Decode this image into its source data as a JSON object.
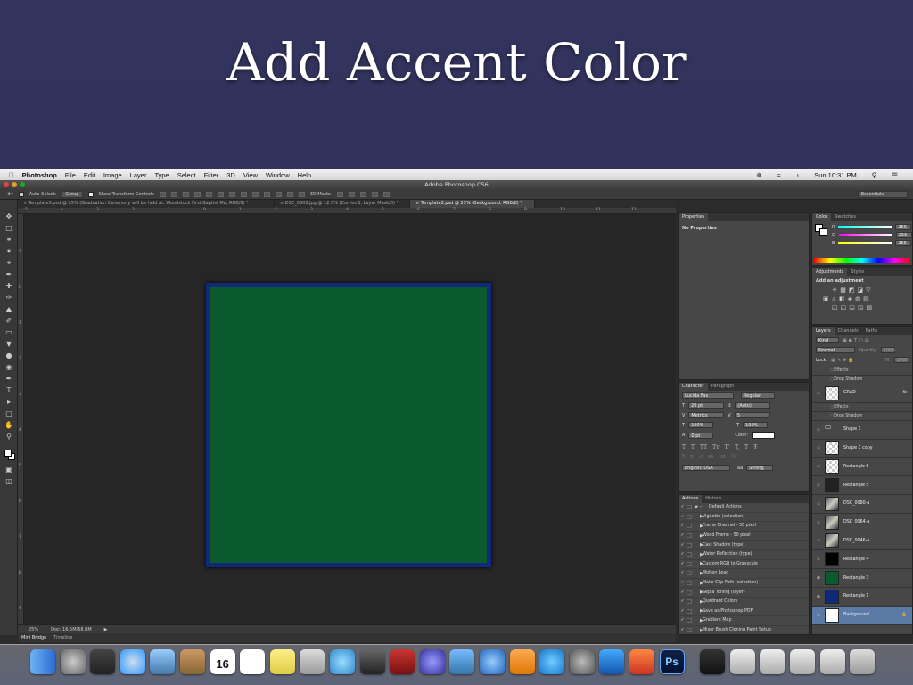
{
  "slide": {
    "title": "Add Accent Color"
  },
  "menubar": {
    "apple": "",
    "app": "Photoshop",
    "items": [
      "File",
      "Edit",
      "Image",
      "Layer",
      "Type",
      "Select",
      "Filter",
      "3D",
      "View",
      "Window",
      "Help"
    ],
    "clock": "Sun 10:31 PM"
  },
  "window": {
    "title": "Adobe Photoshop CS6"
  },
  "options": {
    "auto_select_label": "Auto-Select:",
    "auto_select_value": "Group",
    "show_transform": "Show Transform Controls",
    "mode_3d": "3D Mode:",
    "workspace": "Essentials"
  },
  "tabs": [
    {
      "label": "Template5.psd @ 25% (Graduation Ceremony will be held at: Woodstock First Baptist Ma, RGB/8) *"
    },
    {
      "label": "DSC_0302.jpg @ 12.5% (Curves 1, Layer Mask/8) *"
    },
    {
      "label": "Template2.psd @ 25% (Background, RGB/8) *"
    }
  ],
  "ruler_h": [
    "5",
    "4",
    "3",
    "2",
    "1",
    "0",
    "1",
    "2",
    "3",
    "4",
    "5",
    "6",
    "7",
    "8",
    "9",
    "10",
    "11",
    "12"
  ],
  "ruler_v": [
    "1",
    "0",
    "1",
    "2",
    "3",
    "4",
    "5",
    "6",
    "7",
    "8",
    "9"
  ],
  "status": {
    "zoom": "25%",
    "doc": "Doc: 16.5M/68.8M"
  },
  "bottom_tabs": {
    "mini_bridge": "Mini Bridge",
    "timeline": "Timeline"
  },
  "properties": {
    "tab": "Properties",
    "content": "No Properties"
  },
  "color_panel": {
    "tabs": [
      "Color",
      "Swatches"
    ],
    "channels": [
      {
        "label": "R",
        "value": "255"
      },
      {
        "label": "G",
        "value": "255"
      },
      {
        "label": "B",
        "value": "255"
      }
    ]
  },
  "adjustments": {
    "tabs": [
      "Adjustments",
      "Styles"
    ],
    "heading": "Add an adjustment"
  },
  "character": {
    "tabs": [
      "Character",
      "Paragraph"
    ],
    "font": "Lucida Fax",
    "style": "Regular",
    "size": "20 pt",
    "leading": "(Auto)",
    "kerning": "Metrics",
    "tracking": "5",
    "vscale": "100%",
    "hscale": "100%",
    "baseline": "0 pt",
    "color_label": "Color:",
    "language": "English: USA",
    "aa": "Strong"
  },
  "actions": {
    "tabs": [
      "Actions",
      "History"
    ],
    "items": [
      "Default Actions",
      "Vignette (selection)",
      "Frame Channel - 50 pixel",
      "Wood Frame - 50 pixel",
      "Cast Shadow (type)",
      "Water Reflection (type)",
      "Custom RGB to Grayscale",
      "Molten Lead",
      "Make Clip Path (selection)",
      "Sepia Toning (layer)",
      "Quadrant Colors",
      "Save as Photoshop PDF",
      "Gradient Map",
      "Mixer Brush Cloning Paint Setup"
    ]
  },
  "layers": {
    "tabs": [
      "Layers",
      "Channels",
      "Paths"
    ],
    "kind": "Kind",
    "blend": "Normal",
    "opacity_label": "Opacity:",
    "opacity": "100%",
    "lock_label": "Lock:",
    "fill_label": "Fill:",
    "fill": "100%",
    "rows": [
      {
        "name": "Effects",
        "sub": true
      },
      {
        "name": "Drop Shadow",
        "sub": true
      },
      {
        "name": "GRAD",
        "sub": false,
        "thumb": "checker"
      },
      {
        "name": "Effects",
        "sub": true
      },
      {
        "name": "Drop Shadow",
        "sub": true
      },
      {
        "name": "Shape 1",
        "sub": false,
        "thumb": "group"
      },
      {
        "name": "Shape 1 copy",
        "sub": false,
        "thumb": "checker"
      },
      {
        "name": "Rectangle 6",
        "sub": false,
        "thumb": "checker"
      },
      {
        "name": "Rectangle 5",
        "sub": false,
        "thumb": "dark"
      },
      {
        "name": "DSC_0080-a",
        "sub": false,
        "thumb": "photo"
      },
      {
        "name": "DSC_0064-a",
        "sub": false,
        "thumb": "photo"
      },
      {
        "name": "DSC_0046-a",
        "sub": false,
        "thumb": "photo"
      },
      {
        "name": "Rectangle 4",
        "sub": false,
        "thumb": "black"
      },
      {
        "name": "Rectangle 3",
        "sub": false,
        "thumb": "green"
      },
      {
        "name": "Rectangle 1",
        "sub": false,
        "thumb": "blue"
      },
      {
        "name": "Background",
        "sub": false,
        "thumb": "white"
      }
    ]
  },
  "canvas": {
    "frame_color": "#0f2a78",
    "fill_color": "#0c5b2e"
  },
  "dock": {
    "calendar_day": "16"
  }
}
